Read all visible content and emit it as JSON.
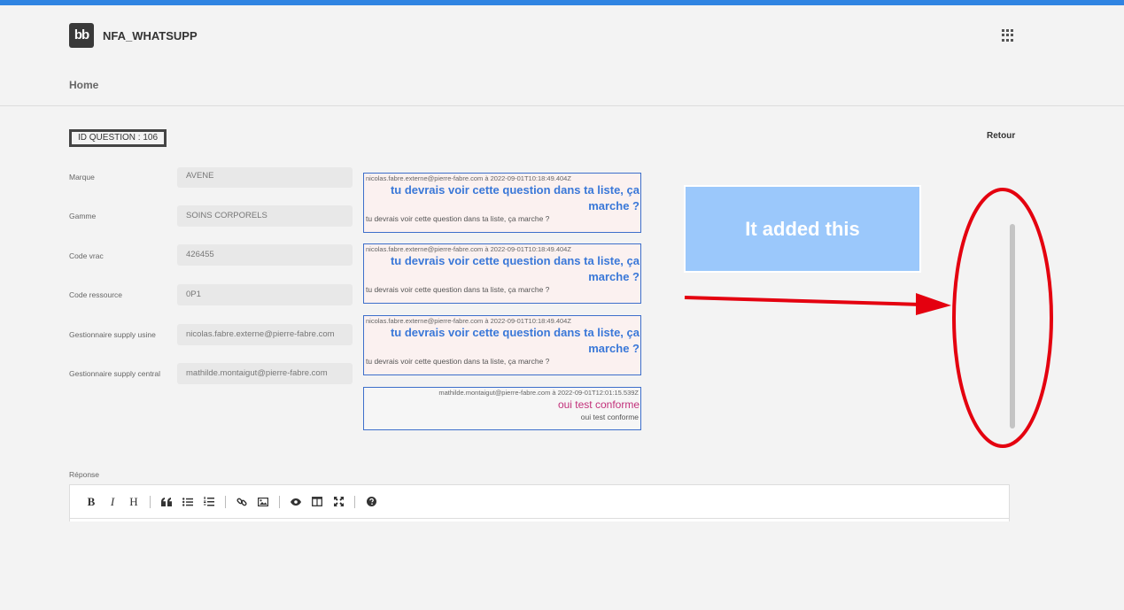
{
  "app": {
    "logo_text": "bb",
    "title": "NFA_WHATSUPP"
  },
  "nav": {
    "home": "Home"
  },
  "question": {
    "id_label": "ID QUESTION : 106",
    "back_label": "Retour"
  },
  "fields": [
    {
      "label": "Marque",
      "value": "AVENE"
    },
    {
      "label": "Gamme",
      "value": "SOINS CORPORELS"
    },
    {
      "label": "Code vrac",
      "value": "426455"
    },
    {
      "label": "Code ressource",
      "value": "0P1"
    },
    {
      "label": "Gestionnaire supply usine",
      "value": "nicolas.fabre.externe@pierre-fabre.com"
    },
    {
      "label": "Gestionnaire supply central",
      "value": "mathilde.montaigut@pierre-fabre.com"
    }
  ],
  "messages": [
    {
      "meta": "nicolas.fabre.externe@pierre-fabre.com à 2022-09-01T10:18:49.404Z",
      "title": "tu devrais voir cette question dans ta liste, ça marche ?",
      "body": "tu devrais voir cette question dans ta liste, ça marche ?"
    },
    {
      "meta": "nicolas.fabre.externe@pierre-fabre.com à 2022-09-01T10:18:49.404Z",
      "title": "tu devrais voir cette question dans ta liste, ça marche ?",
      "body": "tu devrais voir cette question dans ta liste, ça marche ?"
    },
    {
      "meta": "nicolas.fabre.externe@pierre-fabre.com à 2022-09-01T10:18:49.404Z",
      "title": "tu devrais voir cette question dans ta liste, ça marche ?",
      "body": "tu devrais voir cette question dans ta liste, ça marche ?"
    },
    {
      "meta": "mathilde.montaigut@pierre-fabre.com à 2022-09-01T12:01:15.539Z",
      "title": "oui test conforme",
      "body": "oui test conforme"
    }
  ],
  "annotation": {
    "text": "It added this",
    "color": "#e4000f",
    "box_color": "#9bc8fb"
  },
  "reponse": {
    "label": "Réponse",
    "toolbar": [
      "bold-icon",
      "italic-icon",
      "heading-icon",
      "quote-icon",
      "unordered-list-icon",
      "ordered-list-icon",
      "link-icon",
      "image-icon",
      "preview-icon",
      "side-by-side-icon",
      "fullscreen-icon",
      "help-icon"
    ],
    "toolbar_text": {
      "bold": "B",
      "italic": "I",
      "heading": "H"
    }
  },
  "colors": {
    "topbar": "#2f84e2",
    "user_message": "#3a78d8",
    "reply_message": "#c2307a"
  }
}
